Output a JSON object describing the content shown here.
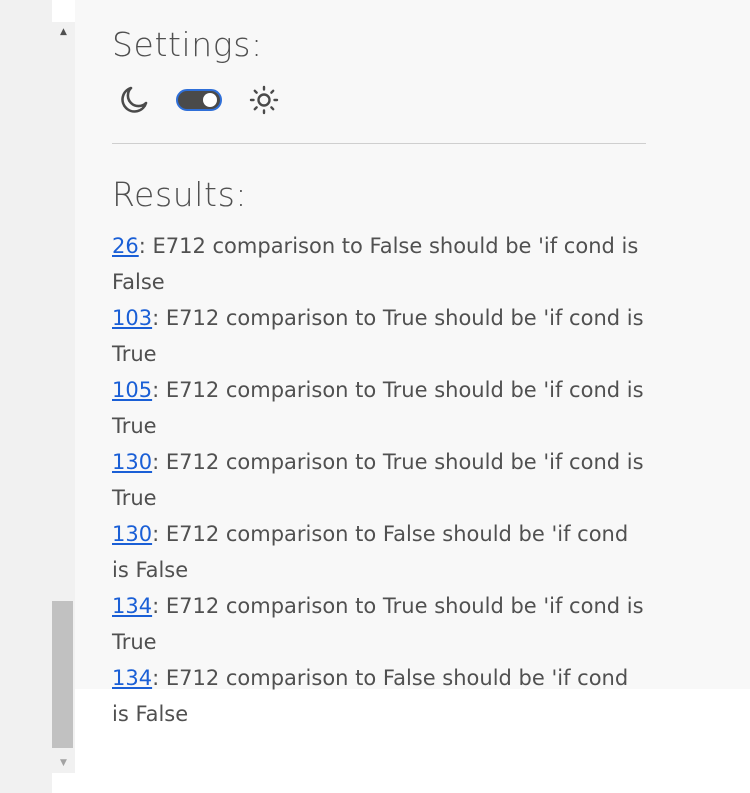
{
  "settings": {
    "heading": "Settings:",
    "theme": {
      "dark_icon": "moon-icon",
      "light_icon": "sun-icon",
      "toggle_state": "on",
      "accent_color": "#2f6fd8"
    }
  },
  "results": {
    "heading": "Results:",
    "items": [
      {
        "line": "26",
        "message": ": E712 comparison to False should be 'if cond is False"
      },
      {
        "line": "103",
        "message": ": E712 comparison to True should be 'if cond is True"
      },
      {
        "line": "105",
        "message": ": E712 comparison to True should be 'if cond is True"
      },
      {
        "line": "130",
        "message": ": E712 comparison to True should be 'if cond is True"
      },
      {
        "line": "130",
        "message": ": E712 comparison to False should be 'if cond is False"
      },
      {
        "line": "134",
        "message": ": E712 comparison to True should be 'if cond is True"
      },
      {
        "line": "134",
        "message": ": E712 comparison to False should be 'if cond is False"
      }
    ]
  },
  "scrollbar": {
    "up_arrow": "▲",
    "down_arrow": "▼"
  }
}
